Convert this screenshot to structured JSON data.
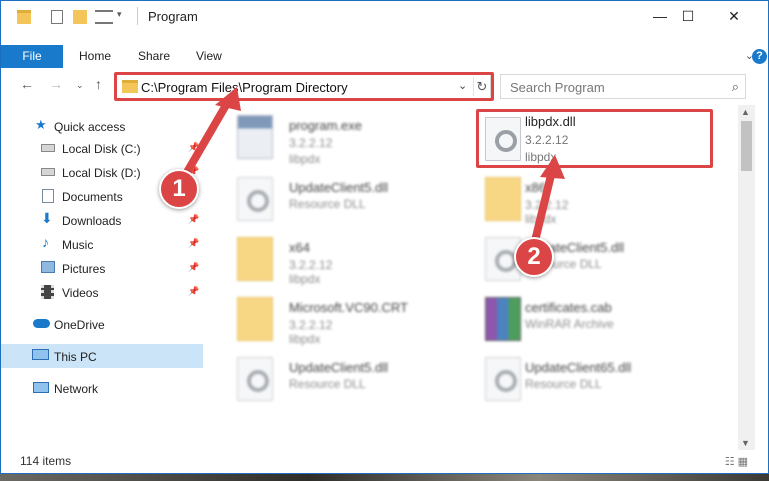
{
  "window": {
    "title": "Program"
  },
  "ribbon": {
    "file_tab": "File",
    "tabs": [
      "Home",
      "Share",
      "View"
    ]
  },
  "address": {
    "path": "C:\\Program Files\\Program Directory"
  },
  "search": {
    "placeholder": "Search Program"
  },
  "sidebar": {
    "items": [
      {
        "label": "Quick access"
      },
      {
        "label": "Local Disk (C:)"
      },
      {
        "label": "Local Disk (D:)"
      },
      {
        "label": "Documents"
      },
      {
        "label": "Downloads"
      },
      {
        "label": "Music"
      },
      {
        "label": "Pictures"
      },
      {
        "label": "Videos"
      },
      {
        "label": "OneDrive"
      },
      {
        "label": "This PC"
      },
      {
        "label": "Network"
      }
    ]
  },
  "files": [
    {
      "name": "program.exe",
      "version": "3.2.2.12",
      "desc": "libpdx"
    },
    {
      "name": "libpdx.dll",
      "version": "3.2.2.12",
      "desc": "libpdx"
    },
    {
      "name": "UpdateClient5.dll",
      "version": "",
      "desc": "Resource DLL"
    },
    {
      "name": "x86",
      "version": "3.2.2.12",
      "desc": "libpdx"
    },
    {
      "name": "x64",
      "version": "3.2.2.12",
      "desc": "libpdx"
    },
    {
      "name": "UpdateClient5.dll",
      "version": "",
      "desc": "Resource DLL"
    },
    {
      "name": "Microsoft.VC90.CRT",
      "version": "3.2.2.12",
      "desc": "libpdx"
    },
    {
      "name": "certificates.cab",
      "version": "",
      "desc": "WinRAR Archive"
    },
    {
      "name": "UpdateClient5.dll",
      "version": "",
      "desc": "Resource DLL"
    },
    {
      "name": "UpdateClient65.dll",
      "version": "",
      "desc": "Resource DLL"
    }
  ],
  "status": {
    "count": "114 items"
  },
  "markers": [
    "1",
    "2"
  ],
  "colors": {
    "accent": "#1979ca",
    "highlight": "#dc4545",
    "selection": "#cce4f7"
  }
}
